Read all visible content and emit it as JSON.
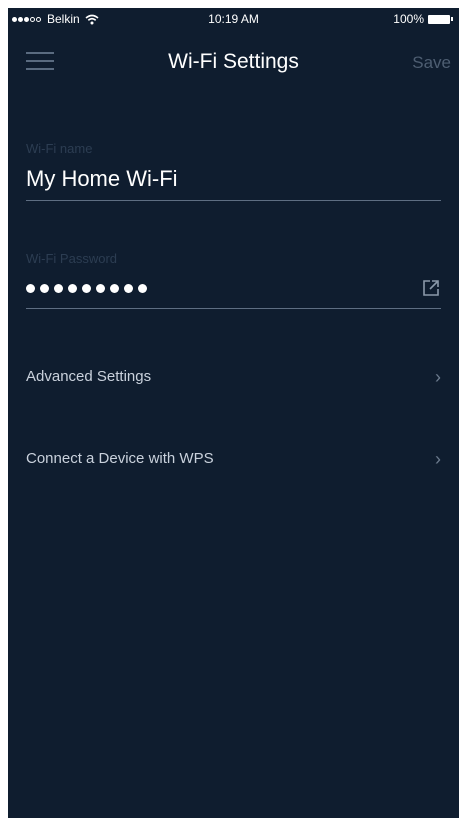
{
  "status_bar": {
    "carrier": "Belkin",
    "time": "10:19 AM",
    "battery": "100%",
    "icons": [
      "signal-dots-icon",
      "wifi-icon",
      "battery-icon"
    ]
  },
  "nav": {
    "menu_icon": "hamburger-menu-icon",
    "title": "Wi-Fi Settings",
    "save_label": "Save"
  },
  "wifi_name": {
    "label": "Wi-Fi name",
    "value": "My Home Wi-Fi"
  },
  "wifi_password": {
    "label": "Wi-Fi Password",
    "masked_value": "•••••••••",
    "action_icon": "share-icon"
  },
  "menu": {
    "items": [
      {
        "label": "Advanced Settings",
        "icon": "chevron-right-icon"
      },
      {
        "label": "Connect a Device with WPS",
        "icon": "chevron-right-icon"
      }
    ]
  },
  "colors": {
    "background": "#0f1d2f",
    "text_primary": "#ffffff",
    "text_dim": "#2c3d52",
    "accent_muted": "#4e5e72"
  }
}
